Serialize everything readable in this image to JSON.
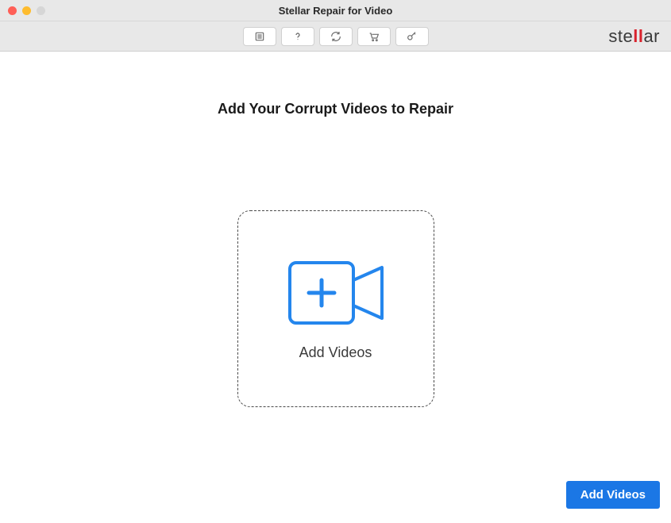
{
  "window": {
    "title": "Stellar Repair for Video"
  },
  "toolbar": {
    "brand_prefix": "ste",
    "brand_ll": "ll",
    "brand_suffix": "ar"
  },
  "main": {
    "heading": "Add Your Corrupt Videos to Repair",
    "dropzone_label": "Add Videos",
    "add_button": "Add Videos"
  }
}
